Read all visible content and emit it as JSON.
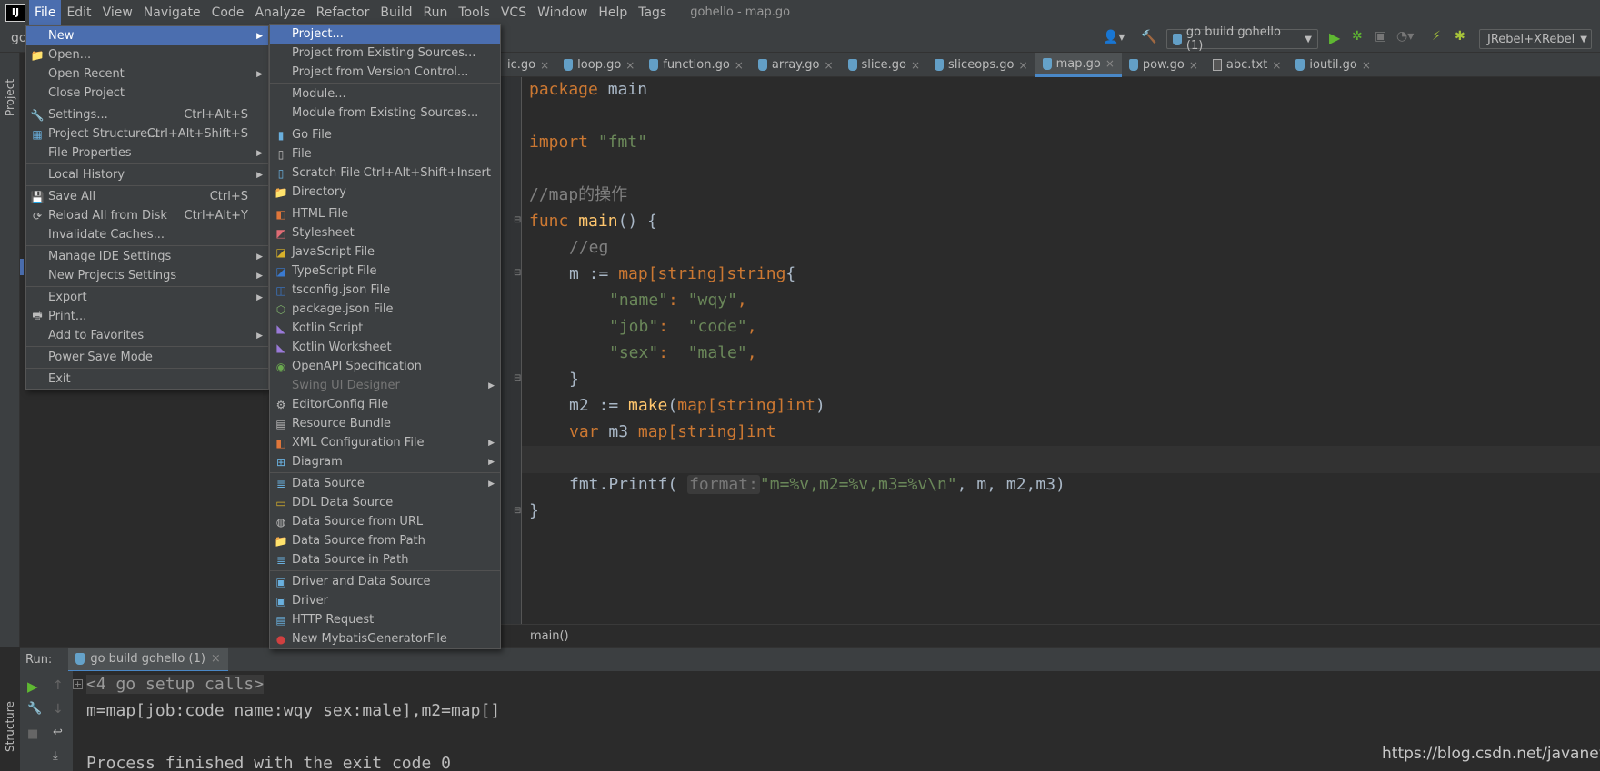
{
  "window_title": "gohello - map.go",
  "menubar": [
    "File",
    "Edit",
    "View",
    "Navigate",
    "Code",
    "Analyze",
    "Refactor",
    "Build",
    "Run",
    "Tools",
    "VCS",
    "Window",
    "Help",
    "Tags"
  ],
  "toolbar": {
    "project_short": "go",
    "run_config": "go build gohello (1)",
    "jrebel": "JRebel+XRebel"
  },
  "sidebar": {
    "project_label": "Project",
    "structure_label": "Structure"
  },
  "tabs": [
    {
      "label": "ic.go",
      "active": false
    },
    {
      "label": "loop.go",
      "active": false
    },
    {
      "label": "function.go",
      "active": false
    },
    {
      "label": "array.go",
      "active": false
    },
    {
      "label": "slice.go",
      "active": false
    },
    {
      "label": "sliceops.go",
      "active": false
    },
    {
      "label": "map.go",
      "active": true
    },
    {
      "label": "pow.go",
      "active": false
    },
    {
      "label": "abc.txt",
      "active": false
    },
    {
      "label": "ioutil.go",
      "active": false
    }
  ],
  "code": {
    "l1_kw": "package",
    "l1_rest": " main",
    "l3_kw": "import",
    "l3_str": "\"fmt\"",
    "l5_cm": "//map的操作",
    "l6_kw": "func",
    "l6_fn": "main",
    "l6_rest": "() {",
    "l7_cm": "//eg",
    "l8_a": "m := ",
    "l8_kw": "map[string]string",
    "l8_b": "{",
    "l9_k": "\"name\"",
    "l9_v": "\"wqy\"",
    "l10_k": "\"job\"",
    "l10_v": "\"code\"",
    "l11_k": "\"sex\"",
    "l11_v": "\"male\"",
    "l12": "}",
    "l13_a": "m2 := ",
    "l13_fn": "make",
    "l13_b": "(",
    "l13_kw": "map[string]int",
    "l13_c": ")",
    "l14_kw": "var",
    "l14_a": " m3 ",
    "l14_kw2": "map[string]int",
    "l16_a": "fmt.Printf(",
    "l16_hint": "format:",
    "l16_str": "\"m=%v,m2=%v,m3=%v\\n\"",
    "l16_b": ", m, m2,m3)",
    "l17": "}"
  },
  "breadcrumb": "main()",
  "run": {
    "label": "Run:",
    "tab": "go build gohello (1)",
    "line1": "<4 go setup calls>",
    "line2": "m=map[job:code name:wqy sex:male],m2=map[]",
    "line3": "Process finished with the exit code 0"
  },
  "watermark": "https://blog.csdn.net/javanewber",
  "file_menu": [
    {
      "label": "New",
      "sub": true,
      "selected": true
    },
    {
      "label": "Open...",
      "icon": "folder-icon"
    },
    {
      "label": "Open Recent",
      "sub": true
    },
    {
      "label": "Close Project"
    },
    {
      "sep": true
    },
    {
      "label": "Settings...",
      "shortcut": "Ctrl+Alt+S",
      "icon": "wrench-icon"
    },
    {
      "label": "Project Structure...",
      "shortcut": "Ctrl+Alt+Shift+S",
      "icon": "structure-icon"
    },
    {
      "label": "File Properties",
      "sub": true
    },
    {
      "sep": true
    },
    {
      "label": "Local History",
      "sub": true
    },
    {
      "sep": true
    },
    {
      "label": "Save All",
      "shortcut": "Ctrl+S",
      "icon": "save-icon"
    },
    {
      "label": "Reload All from Disk",
      "shortcut": "Ctrl+Alt+Y",
      "icon": "reload-icon"
    },
    {
      "label": "Invalidate Caches..."
    },
    {
      "sep": true
    },
    {
      "label": "Manage IDE Settings",
      "sub": true
    },
    {
      "label": "New Projects Settings",
      "sub": true
    },
    {
      "sep": true
    },
    {
      "label": "Export",
      "sub": true
    },
    {
      "label": "Print...",
      "icon": "print-icon"
    },
    {
      "label": "Add to Favorites",
      "sub": true
    },
    {
      "sep": true
    },
    {
      "label": "Power Save Mode"
    },
    {
      "sep": true
    },
    {
      "label": "Exit"
    }
  ],
  "new_menu": [
    {
      "label": "Project...",
      "selected": true
    },
    {
      "label": "Project from Existing Sources..."
    },
    {
      "label": "Project from Version Control..."
    },
    {
      "sep": true
    },
    {
      "label": "Module..."
    },
    {
      "label": "Module from Existing Sources..."
    },
    {
      "sep": true
    },
    {
      "label": "Go File",
      "icon": "go-file-icon"
    },
    {
      "label": "File",
      "icon": "file-icon"
    },
    {
      "label": "Scratch File",
      "shortcut": "Ctrl+Alt+Shift+Insert",
      "icon": "scratch-file-icon"
    },
    {
      "label": "Directory",
      "icon": "folder-icon"
    },
    {
      "sep": true
    },
    {
      "label": "HTML File",
      "icon": "html-icon"
    },
    {
      "label": "Stylesheet",
      "icon": "css-icon"
    },
    {
      "label": "JavaScript File",
      "icon": "js-icon"
    },
    {
      "label": "TypeScript File",
      "icon": "ts-icon"
    },
    {
      "label": "tsconfig.json File",
      "icon": "tsconfig-icon"
    },
    {
      "label": "package.json File",
      "icon": "package-json-icon"
    },
    {
      "label": "Kotlin Script",
      "icon": "kotlin-icon"
    },
    {
      "label": "Kotlin Worksheet",
      "icon": "kotlin-worksheet-icon"
    },
    {
      "label": "OpenAPI Specification",
      "icon": "openapi-icon"
    },
    {
      "label": "Swing UI Designer",
      "sub": true,
      "disabled": true
    },
    {
      "label": "EditorConfig File",
      "icon": "gear-icon"
    },
    {
      "label": "Resource Bundle",
      "icon": "resource-bundle-icon"
    },
    {
      "label": "XML Configuration File",
      "sub": true,
      "icon": "xml-icon"
    },
    {
      "label": "Diagram",
      "sub": true,
      "icon": "diagram-icon"
    },
    {
      "sep": true
    },
    {
      "label": "Data Source",
      "sub": true,
      "icon": "database-icon"
    },
    {
      "label": "DDL Data Source",
      "icon": "ddl-icon"
    },
    {
      "label": "Data Source from URL",
      "icon": "url-icon"
    },
    {
      "label": "Data Source from Path",
      "icon": "folder-icon"
    },
    {
      "label": "Data Source in Path",
      "icon": "database-icon"
    },
    {
      "sep": true
    },
    {
      "label": "Driver and Data Source",
      "icon": "driver-icon"
    },
    {
      "label": "Driver",
      "icon": "driver-icon"
    },
    {
      "label": "HTTP Request",
      "icon": "api-icon"
    },
    {
      "label": "New MybatisGeneratorFile",
      "icon": "mybatis-icon"
    }
  ],
  "colors": {
    "accent": "#4b6eaf",
    "keyword": "#cc7832",
    "string": "#6a8759",
    "comment": "#808080",
    "function": "#ffc66d",
    "bg": "#2b2b2b",
    "panel": "#3c3f41"
  }
}
